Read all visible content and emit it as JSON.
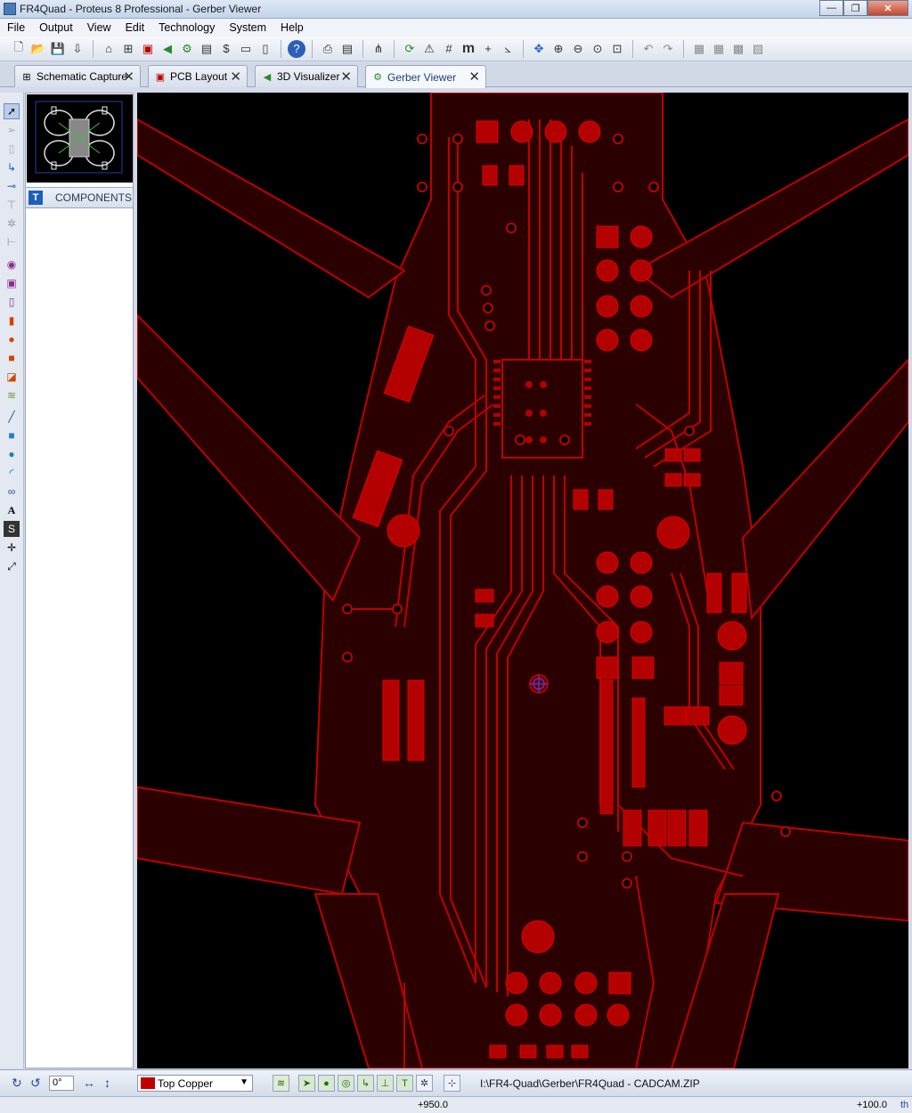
{
  "window": {
    "title": "FR4Quad - Proteus 8 Professional - Gerber Viewer",
    "buttons": {
      "minimize": "—",
      "maximize": "❐",
      "close": "✕"
    }
  },
  "menu": [
    "File",
    "Output",
    "View",
    "Edit",
    "Technology",
    "System",
    "Help"
  ],
  "toolbar": {
    "icons": [
      "new-icon",
      "open-icon",
      "save-icon",
      "import-icon",
      "home-icon",
      "schematic-icon",
      "pcb-icon",
      "gerber-icon",
      "3d-icon",
      "bom-icon",
      "notes-icon",
      "report-icon",
      "help-icon",
      "print-icon",
      "print-setup-icon",
      "netlist-icon",
      "refresh-icon",
      "pick-icon",
      "grid-icon",
      "metric-icon",
      "origin-icon",
      "snap-icon",
      "pan-icon",
      "zoom-in-icon",
      "zoom-out-icon",
      "zoom-all-icon",
      "zoom-area-icon",
      "undo-icon",
      "redo-icon",
      "block-copy-icon",
      "block-move-icon",
      "block-rotate-icon",
      "block-delete-icon"
    ],
    "metric_label": "m"
  },
  "tabs": [
    {
      "label": "Schematic Capture",
      "icon": "schematic-icon",
      "active": false
    },
    {
      "label": "PCB Layout",
      "icon": "pcb-icon",
      "active": false
    },
    {
      "label": "3D Visualizer",
      "icon": "3d-icon",
      "active": false
    },
    {
      "label": "Gerber Viewer",
      "icon": "gerber-icon",
      "active": true
    }
  ],
  "panel": {
    "components_label": "COMPONENTS",
    "badge": "T"
  },
  "statusbar": {
    "angle": "0°",
    "layer": "Top Copper",
    "layer_color": "#c00000",
    "path": "I:\\FR4-Quad\\Gerber\\FR4Quad - CADCAM.ZIP"
  },
  "coords": {
    "x": "+950.0",
    "y": "+100.0",
    "unit": "th"
  },
  "colors": {
    "copper": "#5a0000",
    "copper_edge": "#d00000",
    "pad": "#b30000",
    "background": "#000000"
  }
}
